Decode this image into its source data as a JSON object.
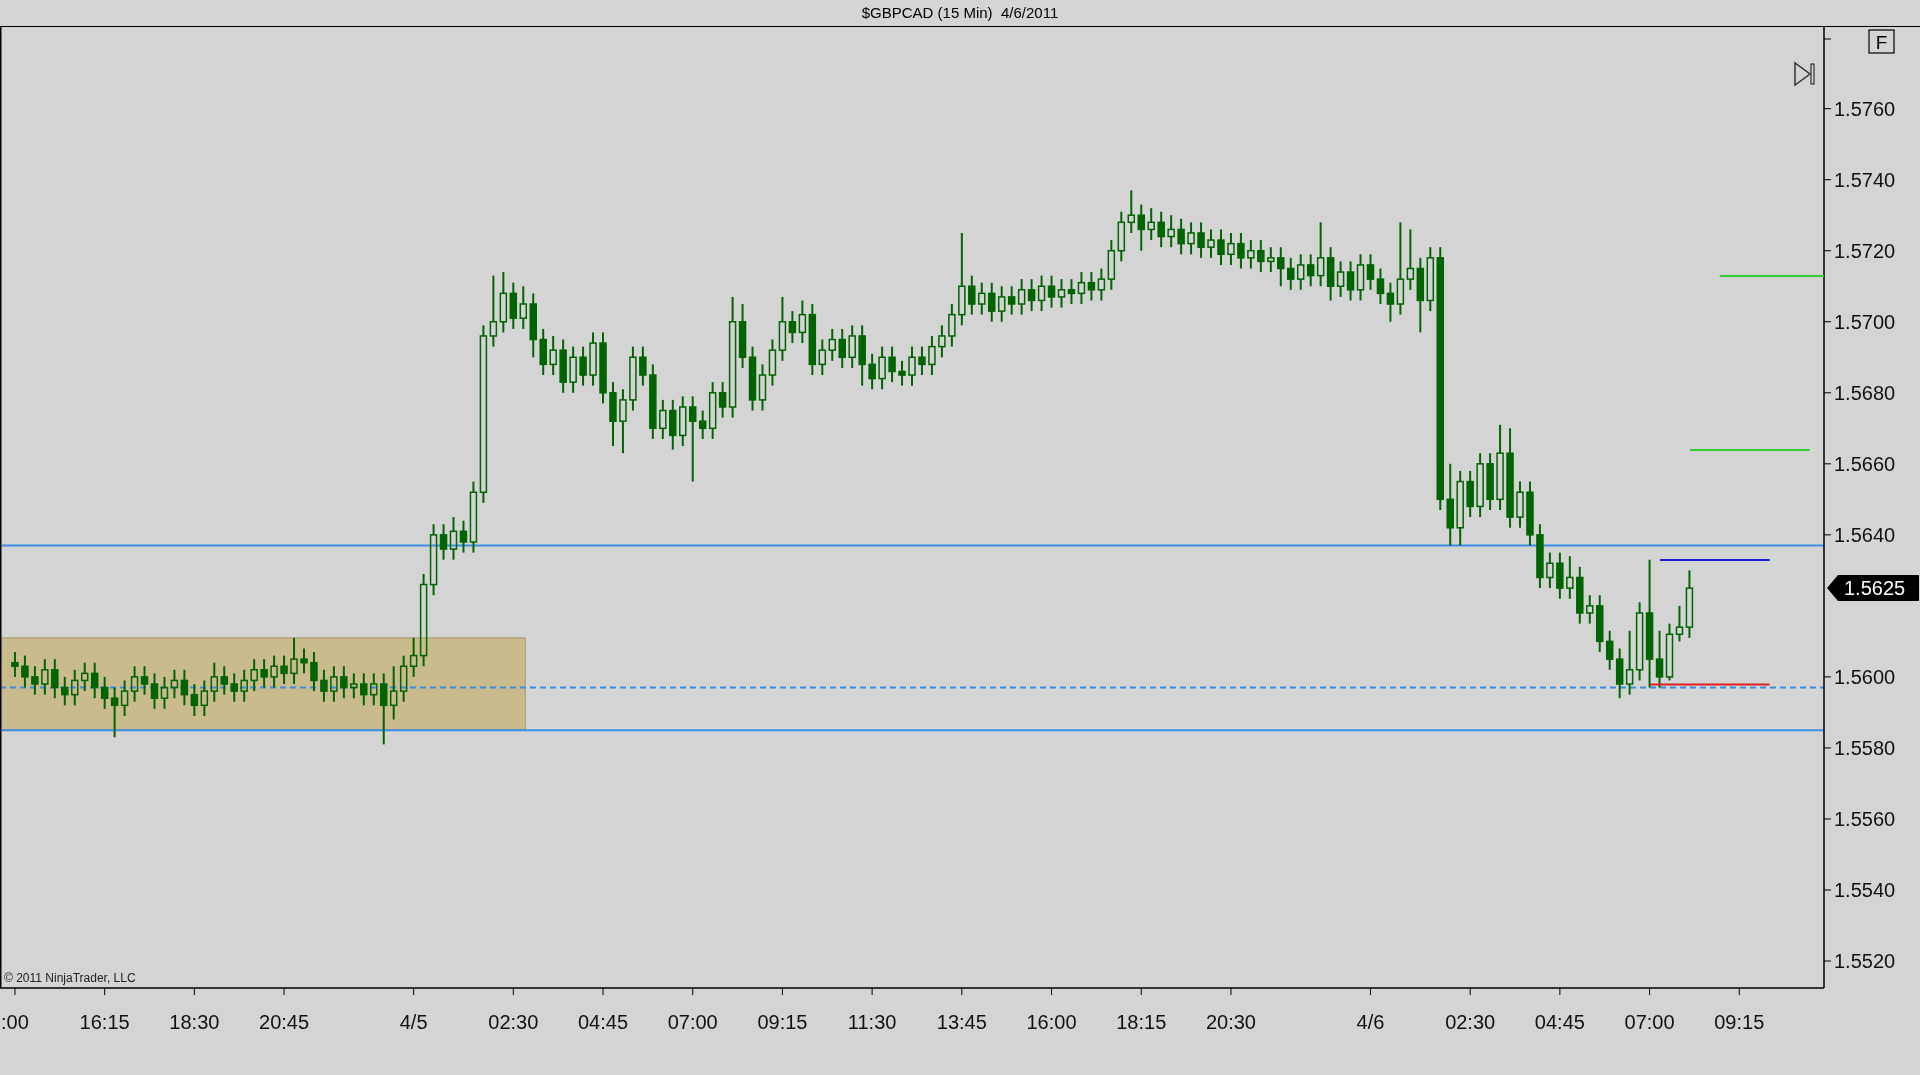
{
  "window": {
    "title": "$GBPCAD (15 Min)  4/6/2011"
  },
  "toolbar": {
    "f_button": "F"
  },
  "chart": {
    "copyright": "© 2011 NinjaTrader, LLC",
    "chart_data": {
      "type": "candlestick",
      "ylim": [
        1.55124,
        1.5783
      ],
      "categories": [
        ":00",
        null,
        null,
        null,
        null,
        null,
        null,
        null,
        null,
        "16:15",
        null,
        null,
        null,
        null,
        null,
        null,
        null,
        null,
        "18:30",
        null,
        null,
        null,
        null,
        null,
        null,
        null,
        null,
        "20:45",
        null,
        null,
        null,
        null,
        null,
        null,
        null,
        null,
        null,
        null,
        null,
        null,
        "4/5",
        null,
        null,
        null,
        null,
        null,
        null,
        null,
        null,
        null,
        "02:30",
        null,
        null,
        null,
        null,
        null,
        null,
        null,
        null,
        "04:45",
        null,
        null,
        null,
        null,
        null,
        null,
        null,
        null,
        "07:00",
        null,
        null,
        null,
        null,
        null,
        null,
        null,
        null,
        "09:15",
        null,
        null,
        null,
        null,
        null,
        null,
        null,
        null,
        "11:30",
        null,
        null,
        null,
        null,
        null,
        null,
        null,
        null,
        "13:45",
        null,
        null,
        null,
        null,
        null,
        null,
        null,
        null,
        "16:00",
        null,
        null,
        null,
        null,
        null,
        null,
        null,
        null,
        "18:15",
        null,
        null,
        null,
        null,
        null,
        null,
        null,
        null,
        "20:30",
        null,
        null,
        null,
        null,
        null,
        null,
        null,
        null,
        null,
        null,
        null,
        null,
        null,
        "4/6",
        null,
        null,
        null,
        null,
        null,
        null,
        null,
        null,
        null,
        "02:30",
        null,
        null,
        null,
        null,
        null,
        null,
        null,
        null,
        "04:45",
        null,
        null,
        null,
        null,
        null,
        null,
        null,
        null,
        "07:00",
        null,
        null,
        null,
        null,
        null,
        null,
        null,
        null,
        "09:15",
        null,
        null,
        null,
        null,
        null,
        null,
        null,
        null
      ],
      "color": "#006400",
      "ohlc": [
        [
          1.5604,
          1.5607,
          1.56,
          1.5603
        ],
        [
          1.5603,
          1.5606,
          1.5597,
          1.56
        ],
        [
          1.56,
          1.5603,
          1.5595,
          1.5598
        ],
        [
          1.5598,
          1.5605,
          1.5595,
          1.5602
        ],
        [
          1.5602,
          1.5605,
          1.5594,
          1.5597
        ],
        [
          1.5597,
          1.56,
          1.5592,
          1.5595
        ],
        [
          1.5595,
          1.5602,
          1.5592,
          1.5599
        ],
        [
          1.5599,
          1.5604,
          1.5596,
          1.5601
        ],
        [
          1.5601,
          1.5604,
          1.5594,
          1.5597
        ],
        [
          1.5597,
          1.56,
          1.5591,
          1.5594
        ],
        [
          1.5594,
          1.5597,
          1.5583,
          1.5592
        ],
        [
          1.5592,
          1.5599,
          1.5589,
          1.5596
        ],
        [
          1.5596,
          1.5603,
          1.5593,
          1.56
        ],
        [
          1.56,
          1.5603,
          1.5595,
          1.5598
        ],
        [
          1.5598,
          1.5601,
          1.5591,
          1.5594
        ],
        [
          1.5594,
          1.56,
          1.5591,
          1.5597
        ],
        [
          1.5597,
          1.5602,
          1.5594,
          1.5599
        ],
        [
          1.5599,
          1.5602,
          1.5592,
          1.5595
        ],
        [
          1.5595,
          1.5598,
          1.5589,
          1.5592
        ],
        [
          1.5592,
          1.5599,
          1.5589,
          1.5596
        ],
        [
          1.5596,
          1.5604,
          1.5593,
          1.56
        ],
        [
          1.56,
          1.5603,
          1.5595,
          1.5598
        ],
        [
          1.5598,
          1.5601,
          1.5593,
          1.5596
        ],
        [
          1.5596,
          1.5602,
          1.5593,
          1.5599
        ],
        [
          1.5599,
          1.5605,
          1.5596,
          1.5602
        ],
        [
          1.5602,
          1.5605,
          1.5597,
          1.56
        ],
        [
          1.56,
          1.5606,
          1.5597,
          1.5603
        ],
        [
          1.5603,
          1.5606,
          1.5598,
          1.5601
        ],
        [
          1.5601,
          1.5611,
          1.5598,
          1.5605
        ],
        [
          1.5605,
          1.5608,
          1.5601,
          1.5604
        ],
        [
          1.5604,
          1.5607,
          1.5596,
          1.5599
        ],
        [
          1.5599,
          1.5602,
          1.5593,
          1.5596
        ],
        [
          1.5596,
          1.5603,
          1.5593,
          1.56
        ],
        [
          1.56,
          1.5603,
          1.5594,
          1.5597
        ],
        [
          1.5597,
          1.5601,
          1.5594,
          1.5598
        ],
        [
          1.5598,
          1.5601,
          1.5592,
          1.5595
        ],
        [
          1.5595,
          1.5601,
          1.5592,
          1.5598
        ],
        [
          1.5598,
          1.5601,
          1.5581,
          1.5592
        ],
        [
          1.5592,
          1.5603,
          1.5588,
          1.5596
        ],
        [
          1.5596,
          1.5606,
          1.5593,
          1.5603
        ],
        [
          1.5603,
          1.5611,
          1.56,
          1.5606
        ],
        [
          1.5606,
          1.5629,
          1.5603,
          1.5626
        ],
        [
          1.5626,
          1.5643,
          1.5623,
          1.564
        ],
        [
          1.564,
          1.5643,
          1.5633,
          1.5636
        ],
        [
          1.5636,
          1.5645,
          1.5633,
          1.5641
        ],
        [
          1.5641,
          1.5644,
          1.5635,
          1.5638
        ],
        [
          1.5638,
          1.5655,
          1.5635,
          1.5652
        ],
        [
          1.5652,
          1.5699,
          1.5649,
          1.5696
        ],
        [
          1.5696,
          1.5713,
          1.5693,
          1.57
        ],
        [
          1.57,
          1.5714,
          1.5697,
          1.5708
        ],
        [
          1.5708,
          1.5711,
          1.5698,
          1.5701
        ],
        [
          1.5701,
          1.571,
          1.5698,
          1.5705
        ],
        [
          1.5705,
          1.5708,
          1.569,
          1.5695
        ],
        [
          1.5695,
          1.5698,
          1.5685,
          1.5688
        ],
        [
          1.5688,
          1.5696,
          1.5685,
          1.5692
        ],
        [
          1.5692,
          1.5695,
          1.568,
          1.5683
        ],
        [
          1.5683,
          1.5693,
          1.568,
          1.569
        ],
        [
          1.569,
          1.5693,
          1.5682,
          1.5685
        ],
        [
          1.5685,
          1.5697,
          1.5682,
          1.5694
        ],
        [
          1.5694,
          1.5697,
          1.5677,
          1.568
        ],
        [
          1.568,
          1.5683,
          1.5665,
          1.5672
        ],
        [
          1.5672,
          1.5681,
          1.5663,
          1.5678
        ],
        [
          1.5678,
          1.5693,
          1.5675,
          1.569
        ],
        [
          1.569,
          1.5693,
          1.5682,
          1.5685
        ],
        [
          1.5685,
          1.5688,
          1.5667,
          1.567
        ],
        [
          1.567,
          1.5678,
          1.5667,
          1.5675
        ],
        [
          1.5675,
          1.5678,
          1.5664,
          1.5668
        ],
        [
          1.5668,
          1.5679,
          1.5665,
          1.5676
        ],
        [
          1.5676,
          1.5679,
          1.5655,
          1.5672
        ],
        [
          1.5672,
          1.5675,
          1.5667,
          1.567
        ],
        [
          1.567,
          1.5683,
          1.5667,
          1.568
        ],
        [
          1.568,
          1.5683,
          1.5673,
          1.5676
        ],
        [
          1.5676,
          1.5707,
          1.5673,
          1.57
        ],
        [
          1.57,
          1.5705,
          1.5687,
          1.569
        ],
        [
          1.569,
          1.5693,
          1.5675,
          1.5678
        ],
        [
          1.5678,
          1.5688,
          1.5675,
          1.5685
        ],
        [
          1.5685,
          1.5695,
          1.5682,
          1.5692
        ],
        [
          1.5692,
          1.5707,
          1.5689,
          1.57
        ],
        [
          1.57,
          1.5703,
          1.5694,
          1.5697
        ],
        [
          1.5697,
          1.5706,
          1.5694,
          1.5702
        ],
        [
          1.5702,
          1.5705,
          1.5685,
          1.5688
        ],
        [
          1.5688,
          1.5695,
          1.5685,
          1.5692
        ],
        [
          1.5692,
          1.5698,
          1.5689,
          1.5695
        ],
        [
          1.5695,
          1.5698,
          1.5687,
          1.569
        ],
        [
          1.569,
          1.5699,
          1.5687,
          1.5696
        ],
        [
          1.5696,
          1.5699,
          1.5682,
          1.5688
        ],
        [
          1.5688,
          1.5691,
          1.5681,
          1.5684
        ],
        [
          1.5684,
          1.5693,
          1.5681,
          1.569
        ],
        [
          1.569,
          1.5693,
          1.5683,
          1.5686
        ],
        [
          1.5686,
          1.5689,
          1.5682,
          1.5685
        ],
        [
          1.5685,
          1.5693,
          1.5682,
          1.569
        ],
        [
          1.569,
          1.5693,
          1.5685,
          1.5688
        ],
        [
          1.5688,
          1.5696,
          1.5685,
          1.5693
        ],
        [
          1.5693,
          1.5699,
          1.569,
          1.5696
        ],
        [
          1.5696,
          1.5705,
          1.5693,
          1.5702
        ],
        [
          1.5702,
          1.5725,
          1.5699,
          1.571
        ],
        [
          1.571,
          1.5713,
          1.5702,
          1.5705
        ],
        [
          1.5705,
          1.5711,
          1.5702,
          1.5708
        ],
        [
          1.5708,
          1.5711,
          1.57,
          1.5703
        ],
        [
          1.5703,
          1.571,
          1.57,
          1.5707
        ],
        [
          1.5707,
          1.571,
          1.5702,
          1.5705
        ],
        [
          1.5705,
          1.5712,
          1.5702,
          1.5709
        ],
        [
          1.5709,
          1.5712,
          1.5703,
          1.5706
        ],
        [
          1.5706,
          1.5713,
          1.5703,
          1.571
        ],
        [
          1.571,
          1.5713,
          1.5704,
          1.5707
        ],
        [
          1.5707,
          1.5712,
          1.5704,
          1.5709
        ],
        [
          1.5709,
          1.5712,
          1.5705,
          1.5708
        ],
        [
          1.5708,
          1.5714,
          1.5705,
          1.5711
        ],
        [
          1.5711,
          1.5714,
          1.5706,
          1.5709
        ],
        [
          1.5709,
          1.5715,
          1.5706,
          1.5712
        ],
        [
          1.5712,
          1.5723,
          1.5709,
          1.572
        ],
        [
          1.572,
          1.5731,
          1.5717,
          1.5728
        ],
        [
          1.5728,
          1.5737,
          1.5725,
          1.573
        ],
        [
          1.573,
          1.5733,
          1.572,
          1.5726
        ],
        [
          1.5726,
          1.5732,
          1.5723,
          1.5728
        ],
        [
          1.5728,
          1.5731,
          1.5721,
          1.5724
        ],
        [
          1.5724,
          1.573,
          1.5721,
          1.5726
        ],
        [
          1.5726,
          1.5729,
          1.5719,
          1.5722
        ],
        [
          1.5722,
          1.5728,
          1.5719,
          1.5725
        ],
        [
          1.5725,
          1.5728,
          1.5718,
          1.5721
        ],
        [
          1.5721,
          1.5726,
          1.5718,
          1.5723
        ],
        [
          1.5723,
          1.5726,
          1.5716,
          1.5719
        ],
        [
          1.5719,
          1.5725,
          1.5716,
          1.5722
        ],
        [
          1.5722,
          1.5725,
          1.5715,
          1.5718
        ],
        [
          1.5718,
          1.5723,
          1.5715,
          1.572
        ],
        [
          1.572,
          1.5723,
          1.5714,
          1.5717
        ],
        [
          1.5717,
          1.5721,
          1.5714,
          1.5718
        ],
        [
          1.5718,
          1.5721,
          1.571,
          1.5715
        ],
        [
          1.5715,
          1.5718,
          1.5709,
          1.5712
        ],
        [
          1.5712,
          1.5719,
          1.5709,
          1.5716
        ],
        [
          1.5716,
          1.5719,
          1.571,
          1.5713
        ],
        [
          1.5713,
          1.5728,
          1.571,
          1.5718
        ],
        [
          1.5718,
          1.5721,
          1.5706,
          1.571
        ],
        [
          1.571,
          1.5717,
          1.5707,
          1.5714
        ],
        [
          1.5714,
          1.5717,
          1.5706,
          1.5709
        ],
        [
          1.5709,
          1.5719,
          1.5706,
          1.5716
        ],
        [
          1.5716,
          1.5719,
          1.5709,
          1.5712
        ],
        [
          1.5712,
          1.5715,
          1.5705,
          1.5708
        ],
        [
          1.5708,
          1.5711,
          1.57,
          1.5705
        ],
        [
          1.5705,
          1.5728,
          1.5702,
          1.5712
        ],
        [
          1.5712,
          1.5726,
          1.5709,
          1.5715
        ],
        [
          1.5715,
          1.5718,
          1.5697,
          1.5706
        ],
        [
          1.5706,
          1.5721,
          1.5703,
          1.5718
        ],
        [
          1.5718,
          1.5721,
          1.5647,
          1.565
        ],
        [
          1.565,
          1.566,
          1.5637,
          1.5642
        ],
        [
          1.5642,
          1.5658,
          1.5637,
          1.5655
        ],
        [
          1.5655,
          1.5658,
          1.5645,
          1.5648
        ],
        [
          1.5648,
          1.5663,
          1.5645,
          1.566
        ],
        [
          1.566,
          1.5663,
          1.5647,
          1.565
        ],
        [
          1.565,
          1.5671,
          1.5647,
          1.5663
        ],
        [
          1.5663,
          1.567,
          1.5642,
          1.5645
        ],
        [
          1.5645,
          1.5655,
          1.5642,
          1.5652
        ],
        [
          1.5652,
          1.5655,
          1.5637,
          1.564
        ],
        [
          1.564,
          1.5643,
          1.5625,
          1.5628
        ],
        [
          1.5628,
          1.5635,
          1.5625,
          1.5632
        ],
        [
          1.5632,
          1.5635,
          1.5622,
          1.5625
        ],
        [
          1.5625,
          1.5634,
          1.5622,
          1.5628
        ],
        [
          1.5628,
          1.5631,
          1.5615,
          1.5618
        ],
        [
          1.5618,
          1.5623,
          1.5615,
          1.562
        ],
        [
          1.562,
          1.5623,
          1.5607,
          1.561
        ],
        [
          1.561,
          1.5613,
          1.5602,
          1.5605
        ],
        [
          1.5605,
          1.5608,
          1.5594,
          1.5598
        ],
        [
          1.5598,
          1.5613,
          1.5595,
          1.5602
        ],
        [
          1.5602,
          1.5621,
          1.5599,
          1.5618
        ],
        [
          1.5618,
          1.5633,
          1.5597,
          1.5605
        ],
        [
          1.5605,
          1.5613,
          1.5597,
          1.56
        ],
        [
          1.56,
          1.5615,
          1.5599,
          1.5612
        ],
        [
          1.5612,
          1.562,
          1.561,
          1.5614
        ],
        [
          1.5614,
          1.563,
          1.5611,
          1.5625
        ],
        null,
        null,
        null,
        null,
        null,
        null,
        null,
        null,
        null,
        null,
        null,
        null,
        null
      ],
      "yticks": [
        {
          "value": 1.552,
          "label": "1.5520"
        },
        {
          "value": 1.554,
          "label": "1.5540"
        },
        {
          "value": 1.556,
          "label": "1.5560"
        },
        {
          "value": 1.558,
          "label": "1.5580"
        },
        {
          "value": 1.56,
          "label": "1.5600"
        },
        {
          "value": 1.564,
          "label": "1.5640"
        },
        {
          "value": 1.566,
          "label": "1.5660"
        },
        {
          "value": 1.568,
          "label": "1.5680"
        },
        {
          "value": 1.57,
          "label": "1.5700"
        },
        {
          "value": 1.572,
          "label": "1.5720"
        },
        {
          "value": 1.574,
          "label": "1.5740"
        },
        {
          "value": 1.576,
          "label": "1.5760"
        }
      ],
      "bands": [
        {
          "axis": "y",
          "from": 1.5585,
          "to": 1.5611,
          "color": "#c9bb8e"
        }
      ],
      "ref_lines": [
        {
          "axis": "y",
          "value": 1.5637,
          "color": "#3a8ee6"
        },
        {
          "axis": "y",
          "value": 1.5597,
          "color": "#3a8ee6"
        },
        {
          "axis": "y",
          "value": 1.5585,
          "color": "#3a8ee6"
        }
      ],
      "annotations": [
        "1.5625"
      ]
    }
  }
}
